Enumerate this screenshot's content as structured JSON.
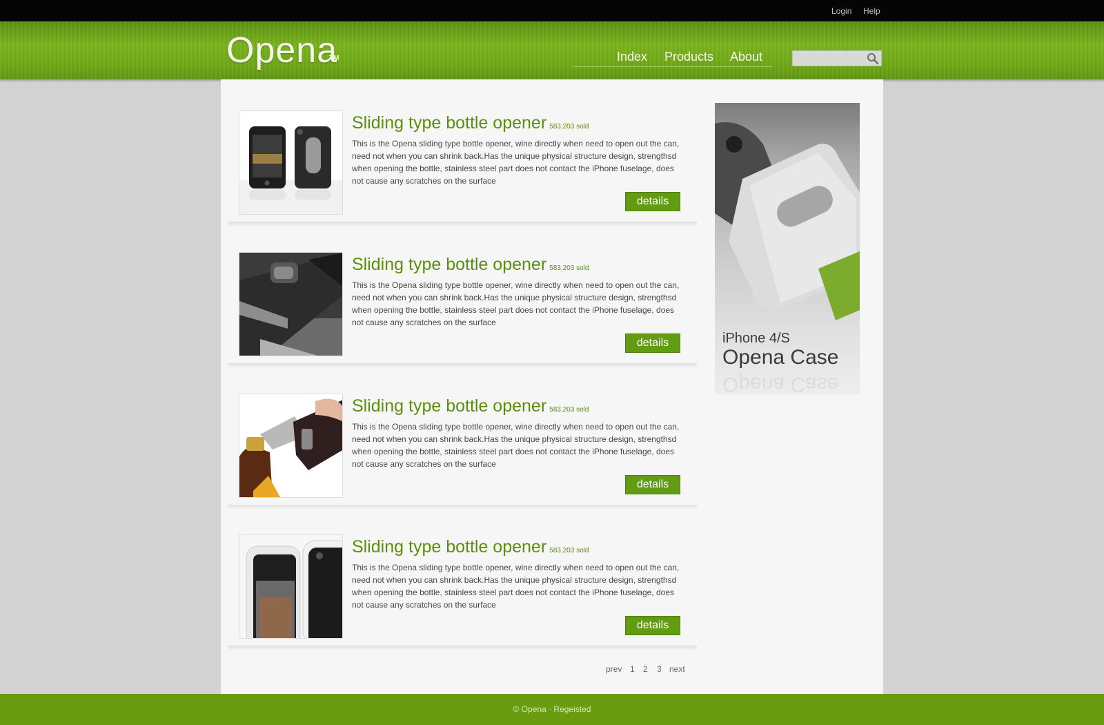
{
  "topbar": {
    "login": "Login",
    "help": "Help"
  },
  "header": {
    "logo": "Opena",
    "trademark": "TM",
    "nav": [
      "Index",
      "Products",
      "About"
    ],
    "search": {
      "placeholder": "",
      "icon": "search-icon"
    }
  },
  "products": [
    {
      "title": "Sliding type bottle opener",
      "sold": "583,203 sold",
      "description": "This is the Opena sliding type bottle opener, wine directly when need to open out the can, need not when you can shrink back.Has the unique physical structure design, strengthsd when opening the bottle, stainless steel part does not contact the iPhone fuselage, does not cause any scratches on the surface",
      "button": "details"
    },
    {
      "title": "Sliding type bottle opener",
      "sold": "583,203 sold",
      "description": "This is the Opena sliding type bottle opener, wine directly when need to open out the can, need not when you can shrink back.Has the unique physical structure design, strengthsd when opening the bottle, stainless steel part does not contact the iPhone fuselage, does not cause any scratches on the surface",
      "button": "details"
    },
    {
      "title": "Sliding type bottle opener",
      "sold": "583,203 sold",
      "description": "This is the Opena sliding type bottle opener, wine directly when need to open out the can, need not when you can shrink back.Has the unique physical structure design, strengthsd when opening the bottle, stainless steel part does not contact the iPhone fuselage, does not cause any scratches on the surface",
      "button": "details"
    },
    {
      "title": "Sliding type bottle opener",
      "sold": "583,203 sold",
      "description": "This is the Opena sliding type bottle opener, wine directly when need to open out the can, need not when you can shrink back.Has the unique physical structure design, strengthsd when opening the bottle, stainless steel part does not contact the iPhone fuselage, does not cause any scratches on the surface",
      "button": "details"
    }
  ],
  "pagination": {
    "prev": "prev",
    "pages": [
      "1",
      "2",
      "3"
    ],
    "next": "next"
  },
  "banner": {
    "line1": "iPhone 4/S",
    "line2": "Opena Case"
  },
  "footer": {
    "text": "© Opena · Regeisted"
  },
  "colors": {
    "brand_green": "#6a9c10",
    "title_green": "#5c8e0e",
    "topbar": "#050505",
    "background": "#d2d2d2"
  }
}
